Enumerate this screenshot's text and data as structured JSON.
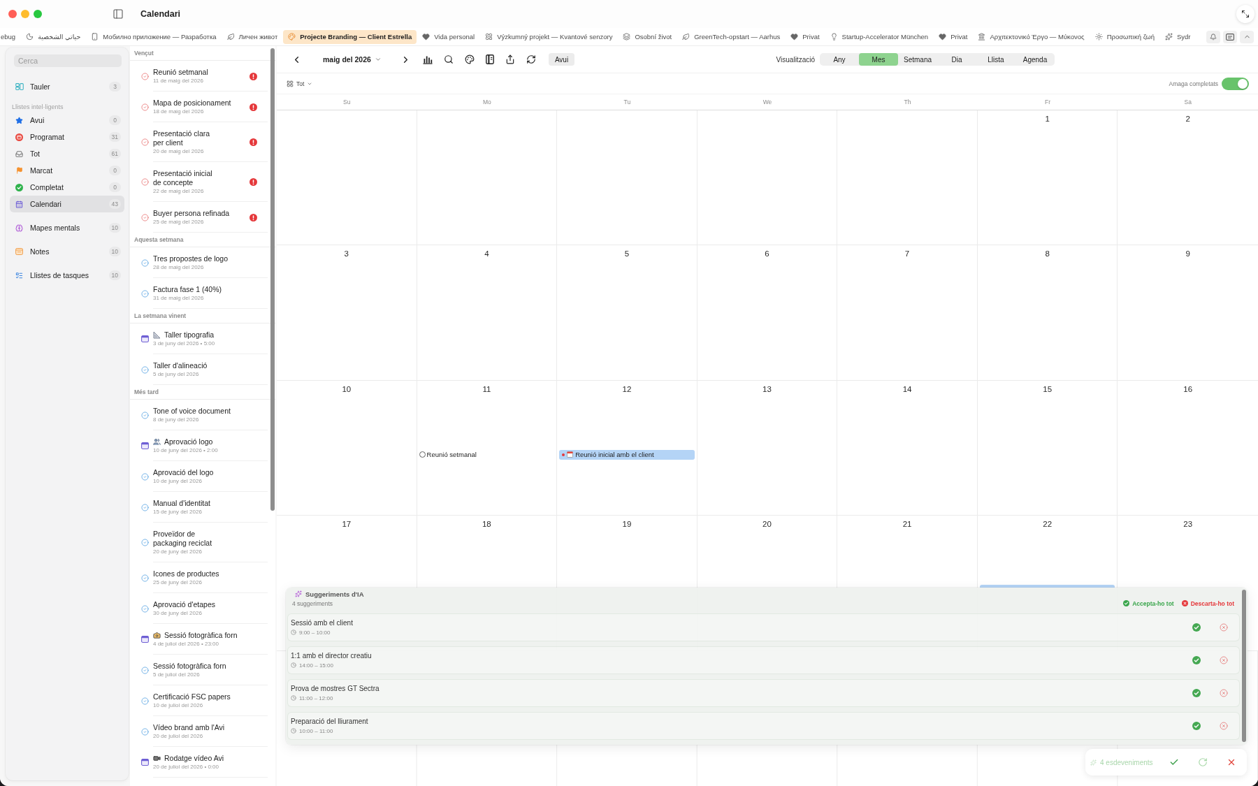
{
  "window": {
    "title": "Calendari"
  },
  "tabs": [
    {
      "label": "ebug",
      "selected": false
    },
    {
      "label": "حياتي الشخصية",
      "selected": false
    },
    {
      "label": "Мобилно приложение — Разработка",
      "selected": false
    },
    {
      "label": "Личен живот",
      "selected": false
    },
    {
      "label": "Projecte Branding — Client Estrella",
      "selected": true
    },
    {
      "label": "Vida personal",
      "selected": false
    },
    {
      "label": "Výzkumný projekt — Kvantové senzory",
      "selected": false
    },
    {
      "label": "Osobní život",
      "selected": false
    },
    {
      "label": "GreenTech-opstart — Aarhus",
      "selected": false
    },
    {
      "label": "Privat",
      "selected": false
    },
    {
      "label": "Startup-Accelerator München",
      "selected": false
    },
    {
      "label": "Privat",
      "selected": false
    },
    {
      "label": "Αρχιτεκτονικό Έργο — Μύκονος",
      "selected": false
    },
    {
      "label": "Προσωπική ζωή",
      "selected": false
    },
    {
      "label": "Sydr",
      "selected": false
    }
  ],
  "sidebar": {
    "search": {
      "placeholder": "Cerca"
    },
    "top_items": [
      {
        "label": "Tauler",
        "count": "3",
        "selected": false
      }
    ],
    "smart_lists": {
      "title": "Llistes intel·ligents",
      "items": [
        {
          "label": "Avui",
          "count": "0",
          "selected": false
        },
        {
          "label": "Programat",
          "count": "31",
          "selected": false
        },
        {
          "label": "Tot",
          "count": "61",
          "selected": false
        },
        {
          "label": "Marcat",
          "count": "0",
          "selected": false
        },
        {
          "label": "Completat",
          "count": "0",
          "selected": false
        },
        {
          "label": "Calendari",
          "count": "43",
          "selected": true
        }
      ]
    },
    "bottom_items": [
      {
        "label": "Mapes mentals",
        "count": "10",
        "selected": false
      },
      {
        "label": "Notes",
        "count": "10",
        "selected": false
      },
      {
        "label": "Llistes de tasques",
        "count": "10",
        "selected": false
      }
    ]
  },
  "task_list": {
    "sections": [
      {
        "title": "Vençut",
        "items": [
          {
            "kind": "task",
            "title": "Reunió setmanal",
            "date": "11 de maig del 2026",
            "overdue": true
          },
          {
            "kind": "task",
            "title": "Mapa de posicionament",
            "date": "18 de maig del 2026",
            "overdue": true
          },
          {
            "kind": "task",
            "title": "Presentació clara\nper client",
            "date": "20 de maig del 2026",
            "overdue": true
          },
          {
            "kind": "task",
            "title": "Presentació inicial\nde concepte",
            "date": "22 de maig del 2026",
            "overdue": true
          },
          {
            "kind": "task",
            "title": "Buyer persona refinada",
            "date": "25 de maig del 2026",
            "overdue": true
          }
        ]
      },
      {
        "title": "Aquesta setmana",
        "items": [
          {
            "kind": "task",
            "title": "Tres propostes de logo",
            "date": "28 de maig del 2026",
            "overdue": false
          },
          {
            "kind": "task",
            "title": "Factura fase 1 (40%)",
            "date": "31 de maig del 2026",
            "overdue": false
          }
        ]
      },
      {
        "title": "La setmana vinent",
        "items": [
          {
            "kind": "event",
            "title": "Taller tipografia",
            "date": "3 de juny del 2026 • 5:00",
            "overdue": false
          },
          {
            "kind": "task",
            "title": "Taller d'alineació",
            "date": "5 de juny del 2026",
            "overdue": false
          }
        ]
      },
      {
        "title": "Més tard",
        "items": [
          {
            "kind": "task",
            "title": "Tone of voice document",
            "date": "8 de juny del 2026",
            "overdue": false
          },
          {
            "kind": "event",
            "title": "Aprovació logo",
            "date": "10 de juny del 2026 • 2:00",
            "overdue": false
          },
          {
            "kind": "task",
            "title": "Aprovació del logo",
            "date": "10 de juny del 2026",
            "overdue": false
          },
          {
            "kind": "task",
            "title": "Manual d'identitat",
            "date": "15 de juny del 2026",
            "overdue": false
          },
          {
            "kind": "task",
            "title": "Proveïdor de\npackaging reciclat",
            "date": "20 de juny del 2026",
            "overdue": false
          },
          {
            "kind": "task",
            "title": "Icones de productes",
            "date": "25 de juny del 2026",
            "overdue": false
          },
          {
            "kind": "task",
            "title": "Aprovació d'etapes",
            "date": "30 de juny del 2026",
            "overdue": false
          },
          {
            "kind": "event",
            "title": "Sessió fotogràfica forn",
            "date": "4 de juliol del 2026 • 23:00",
            "overdue": false
          },
          {
            "kind": "task",
            "title": "Sessió fotogràfica forn",
            "date": "5 de juliol del 2026",
            "overdue": false
          },
          {
            "kind": "task",
            "title": "Certificació FSC papers",
            "date": "10 de juliol del 2026",
            "overdue": false
          },
          {
            "kind": "task",
            "title": "Vídeo brand amb l'Avi",
            "date": "20 de juliol del 2026",
            "overdue": false
          },
          {
            "kind": "event",
            "title": "Rodatge vídeo Avi",
            "date": "20 de juliol del 2026 • 0:00",
            "overdue": false
          }
        ]
      }
    ]
  },
  "calendar": {
    "month": "maig del 2026",
    "today_button": "Avui",
    "view_label": "Visualització",
    "views": [
      {
        "label": "Any",
        "selected": false
      },
      {
        "label": "Mes",
        "selected": true
      },
      {
        "label": "Setmana",
        "selected": false
      },
      {
        "label": "Dia",
        "selected": false
      },
      {
        "label": "Llista",
        "selected": false
      },
      {
        "label": "Agenda",
        "selected": false
      }
    ],
    "filter": "Tot",
    "hide_completed": {
      "label": "Amaga completats",
      "on": true
    },
    "weekdays": [
      "Su",
      "Mo",
      "Tu",
      "We",
      "Th",
      "Fr",
      "Sa"
    ],
    "weeks": [
      [
        {
          "day": "1"
        },
        {
          "day": "2"
        }
      ],
      [
        {
          "day": "3"
        },
        {
          "day": "4"
        },
        {
          "day": "5"
        },
        {
          "day": "6"
        },
        {
          "day": "7"
        },
        {
          "day": "8"
        },
        {
          "day": "9"
        }
      ],
      [
        {
          "day": "10"
        },
        {
          "day": "11",
          "events": [
            {
              "kind": "task",
              "title": "Reunió setmanal",
              "checked": false
            }
          ]
        },
        {
          "day": "12",
          "events": [
            {
              "kind": "event",
              "title": "Reunió inicial amb el client"
            }
          ]
        },
        {
          "day": "13"
        },
        {
          "day": "14"
        },
        {
          "day": "15"
        },
        {
          "day": "16"
        }
      ],
      [
        {
          "day": "17"
        },
        {
          "day": "18"
        },
        {
          "day": "19"
        },
        {
          "day": "20"
        },
        {
          "day": "21"
        },
        {
          "day": "22",
          "events": [
            {
              "kind": "covered"
            }
          ]
        },
        {
          "day": "23"
        }
      ]
    ]
  },
  "ai_suggestions": {
    "title": "Suggeriments d'IA",
    "count": "4 suggeriments",
    "accept_all": "Accepta-ho tot",
    "discard_all": "Descarta-ho tot",
    "items": [
      {
        "title": "Sessió amb el client",
        "time": "9:00 – 10:00"
      },
      {
        "title": "1:1 amb el director creatiu",
        "time": "14:00 – 15:00"
      },
      {
        "title": "Prova de mostres GT Sectra",
        "time": "11:00 – 12:00"
      },
      {
        "title": "Preparació del lliurament",
        "time": "10:00 – 11:00"
      }
    ]
  },
  "event_bar": {
    "label": "4 esdeveniments"
  }
}
